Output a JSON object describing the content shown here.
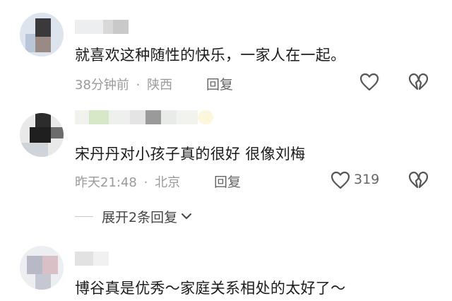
{
  "comments": [
    {
      "text": "就喜欢这种随性的快乐，一家人在一起。",
      "time": "38分钟前",
      "location": "陕西",
      "reply_label": "回复"
    },
    {
      "text": "宋丹丹对小孩子真的很好 很像刘梅",
      "time": "昨天21:48",
      "location": "北京",
      "reply_label": "回复",
      "like_count": "319"
    },
    {
      "text": "博谷真是优秀～家庭关系相处的太好了～"
    }
  ],
  "expand_replies": {
    "label": "展开2条回复"
  },
  "meta_separator": "·",
  "icons": {
    "like": "heart-outline-icon",
    "dislike": "broken-heart-icon",
    "expand": "chevron-down-icon"
  },
  "colors": {
    "text": "#1b1b1b",
    "meta": "#9a9a9a",
    "icon": "#555555"
  }
}
